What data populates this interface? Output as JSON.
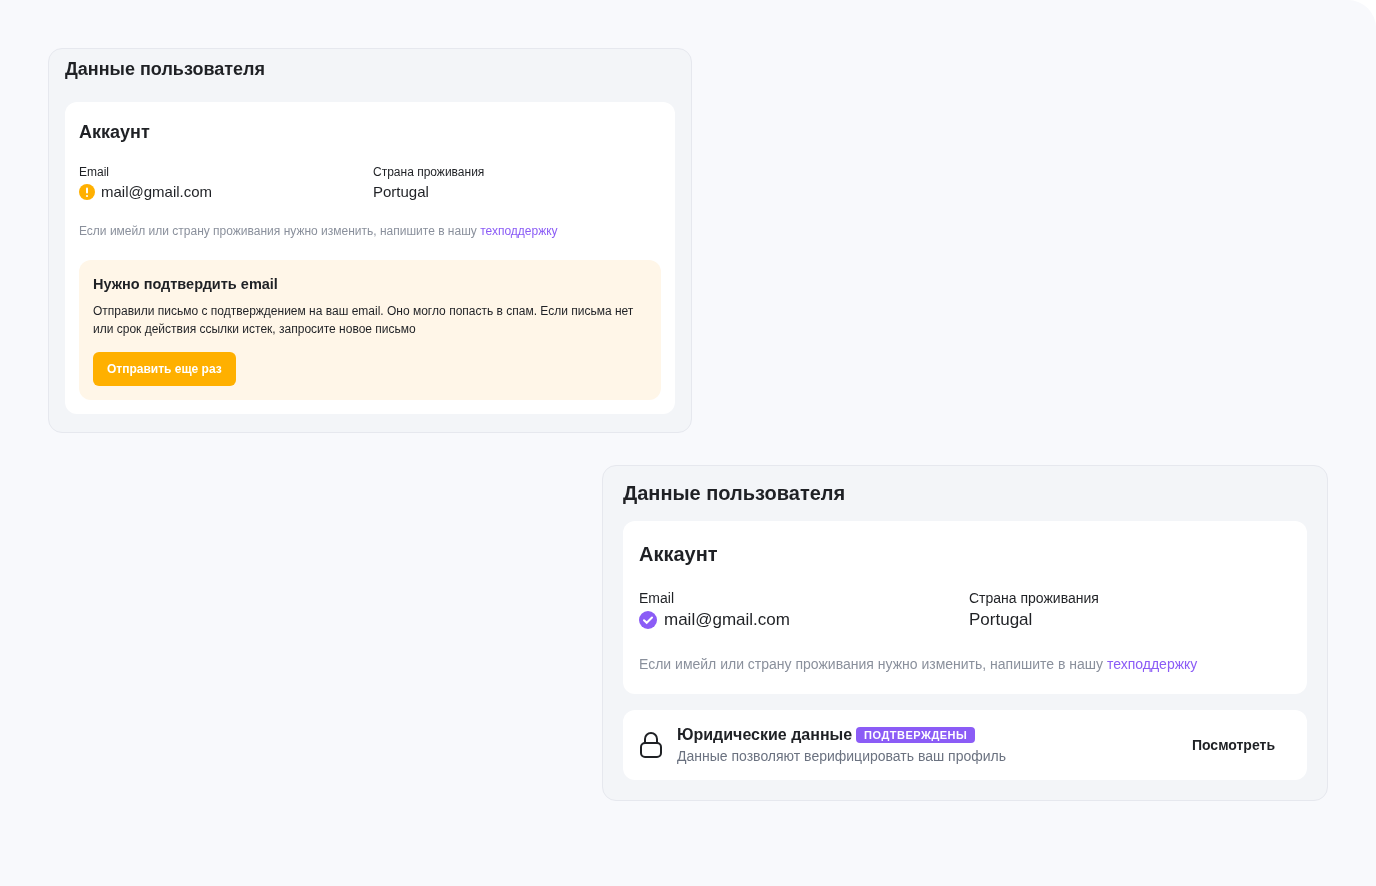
{
  "panels": [
    {
      "title": "Данные пользователя",
      "kind": "compact",
      "account": {
        "title": "Аккаунт",
        "email_label": "Email",
        "email": "mail@gmail.com",
        "email_verified": false,
        "country_label": "Страна проживания",
        "country": "Portugal",
        "note": "Если имейл или страну проживания нужно изменить, напишите в нашу",
        "note_link": "техподдержку"
      },
      "alert": {
        "title": "Нужно подтвердить email",
        "text": "Отправили письмо с подтверждением на ваш email. Оно могло попасть в спам. Если письма нет или срок действия ссылки истек, запросите новое письмо",
        "button": "Отправить еще раз"
      }
    },
    {
      "title": "Данные пользователя",
      "kind": "large",
      "account": {
        "title": "Аккаунт",
        "email_label": "Email",
        "email": "mail@gmail.com",
        "email_verified": true,
        "country_label": "Страна проживания",
        "country": "Portugal",
        "note": "Если имейл или страну проживания нужно изменить, напишите в нашу",
        "note_link": "техподдержку"
      },
      "legal": {
        "title": "Юридические данные",
        "badge": "ПОДТВЕРЖДЕНЫ",
        "subtitle": "Данные позволяют верифицировать ваш профиль",
        "action": "Посмотреть"
      }
    }
  ]
}
